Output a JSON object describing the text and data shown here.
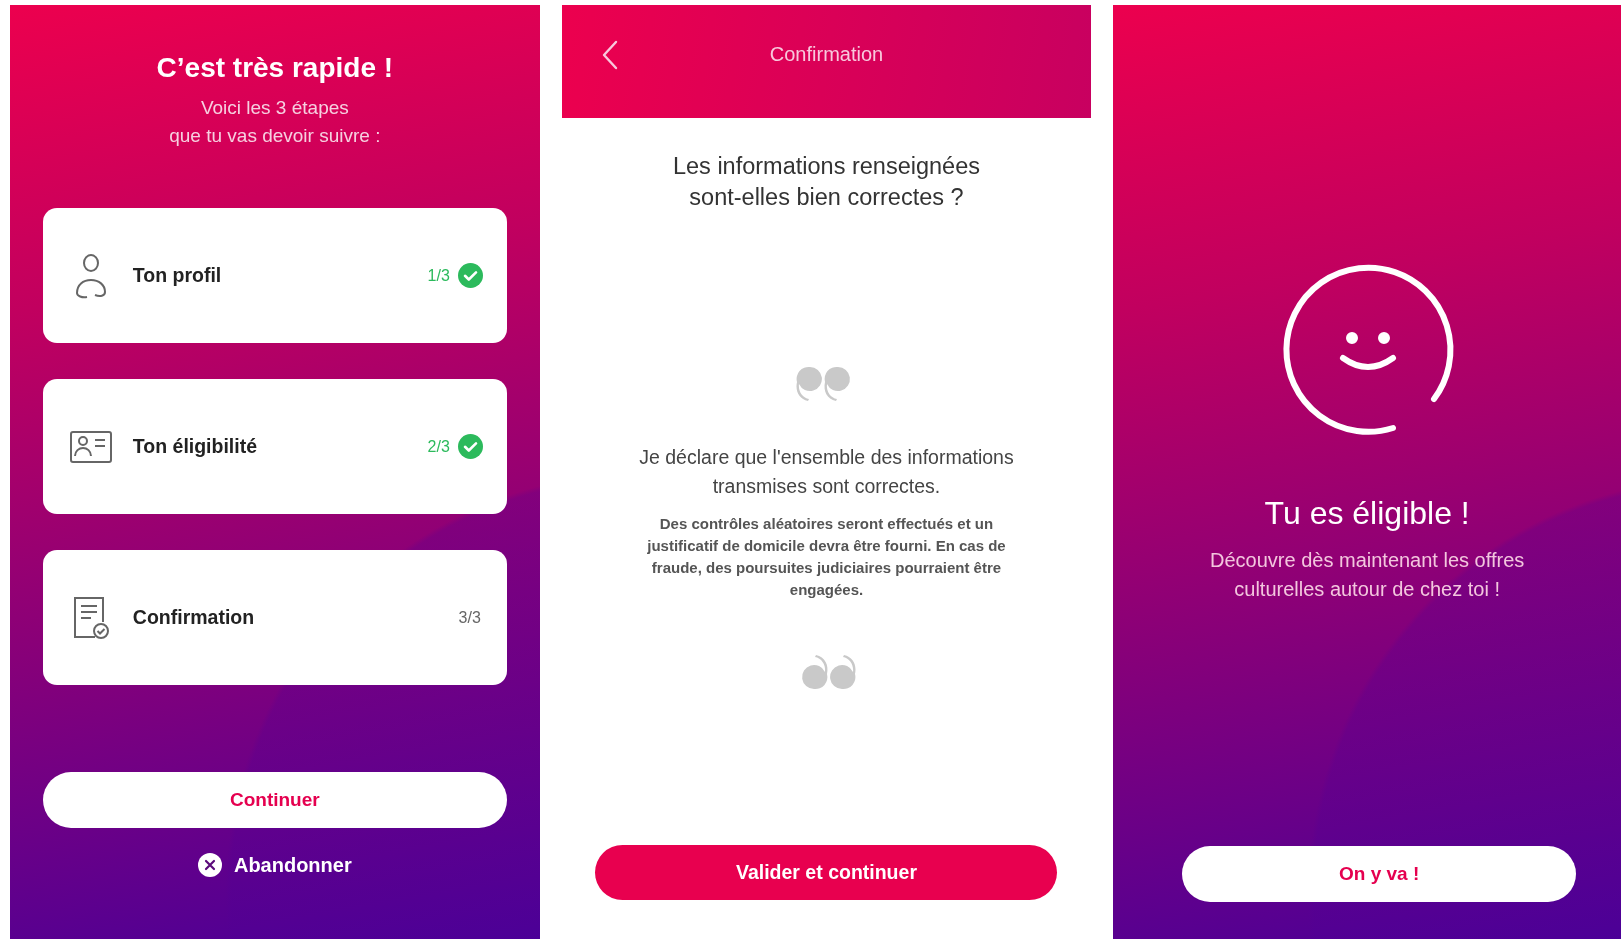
{
  "steps_screen": {
    "title": "C’est très rapide !",
    "subtitle": "Voici les 3 étapes\nque tu vas devoir suivre :",
    "steps": [
      {
        "kind": "profile",
        "label": "Ton profil",
        "counter": "1/3",
        "done": true
      },
      {
        "kind": "id-card",
        "label": "Ton éligibilité",
        "counter": "2/3",
        "done": true
      },
      {
        "kind": "document",
        "label": "Confirmation",
        "counter": "3/3",
        "done": false
      }
    ],
    "primary_button": "Continuer",
    "cancel_link": "Abandonner"
  },
  "confirmation_screen": {
    "header_title": "Confirmation",
    "question": "Les informations renseignées\nsont-elles bien correctes ?",
    "declaration": "Je déclare que l'ensemble des informations transmises sont correctes.",
    "notice": "Des contrôles aléatoires seront effectués et un justificatif de domicile devra être fourni. En cas de fraude, des poursuites judiciaires pourraient être engagées.",
    "button": "Valider et continuer"
  },
  "eligible_screen": {
    "title": "Tu es éligible !",
    "message": "Découvre dès maintenant les offres\nculturelles autour de chez toi !",
    "button": "On y va !"
  }
}
